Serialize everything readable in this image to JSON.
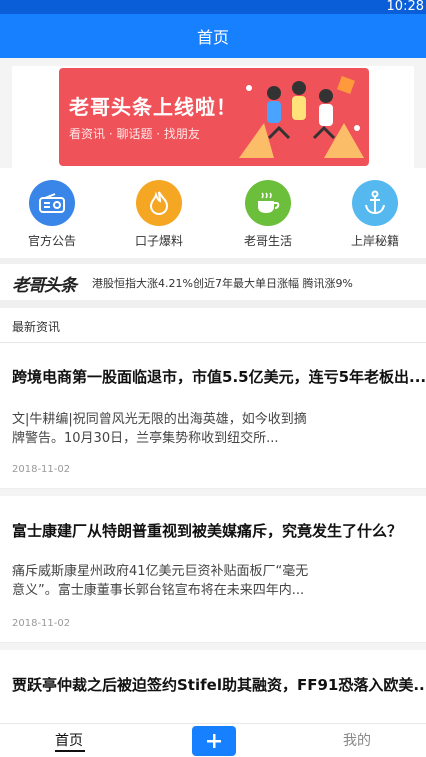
{
  "status": {
    "time": "10:28"
  },
  "appbar": {
    "title": "首页"
  },
  "banner": {
    "title": "老哥头条上线啦！",
    "subtitle": "看资讯 · 聊话题 · 找朋友",
    "bg_color": "#f0525a"
  },
  "quick_actions": [
    {
      "label": "官方公告",
      "icon": "radio-icon",
      "color": "#3a86e8"
    },
    {
      "label": "口子爆料",
      "icon": "flame-icon",
      "color": "#f5a623"
    },
    {
      "label": "老哥生活",
      "icon": "coffee-cup-icon",
      "color": "#6bbf3a"
    },
    {
      "label": "上岸秘籍",
      "icon": "anchor-icon",
      "color": "#55b8ee"
    }
  ],
  "ticker": {
    "logo": "老哥头条",
    "text": "港股恒指大涨4.21%创近7年最大单日涨幅 腾讯涨9%"
  },
  "news": {
    "header": "最新资讯",
    "articles": [
      {
        "title": "跨境电商第一股面临退市，市值5.5亿美元，连亏5年老板出...",
        "snippet": "文|牛耕编|祝同曾风光无限的出海英雄，如今收到摘牌警告。10月30日，兰亭集势称收到纽交所...",
        "date": "2018-11-02"
      },
      {
        "title": "富士康建厂从特朗普重视到被美媒痛斥，究竟发生了什么？",
        "snippet": "痛斥威斯康星州政府41亿美元巨资补贴面板厂“毫无意义”。富士康董事长郭台铭宣布将在未来四年内...",
        "date": "2018-11-02"
      },
      {
        "title": "贾跃亭仲裁之后被迫签约Stifel助其融资，FF91恐落入欧美...",
        "snippet": "",
        "date": ""
      }
    ]
  },
  "tabbar": {
    "home": "首页",
    "add": "+",
    "me": "我的"
  },
  "colors": {
    "primary": "#1780ff",
    "statusbar": "#0a5fd9"
  }
}
